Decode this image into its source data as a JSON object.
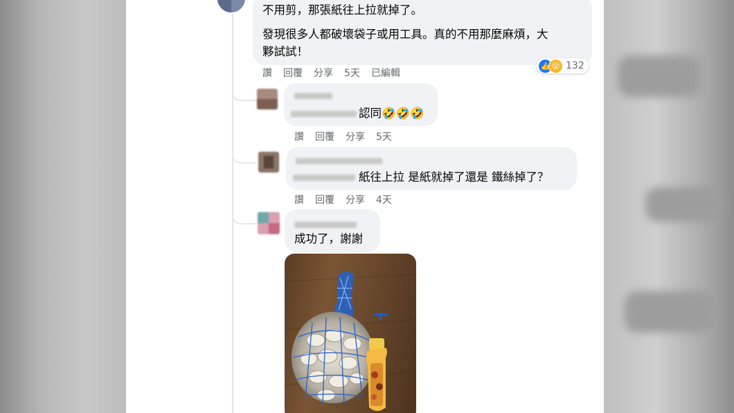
{
  "main_comment": {
    "line1": "不用剪，那張紙往上拉就掉了。",
    "line2": "發現很多人都破壞袋子或用工具。真的不用那麼麻煩，大",
    "line3": "夥試試！",
    "actions": {
      "like": "讚",
      "reply": "回覆",
      "share": "分享",
      "time": "5天",
      "edited": "已編輯"
    },
    "reaction_icons": [
      "like-icon",
      "wow-icon"
    ],
    "reaction_count": "132"
  },
  "replies": [
    {
      "text": "認同🤣🤣🤣",
      "actions": {
        "like": "讚",
        "reply": "回覆",
        "share": "分享",
        "time": "5天"
      }
    },
    {
      "text": "紙往上拉 是紙就掉了還是 鐵絲掉了？",
      "actions": {
        "like": "讚",
        "reply": "回覆",
        "share": "分享",
        "time": "4天"
      }
    },
    {
      "text": "成功了，謝謝"
    }
  ],
  "colors": {
    "bubble": "#f0f2f5",
    "action_text": "#65676b",
    "like_blue": "#1877f2",
    "wow_yellow": "#f7b928"
  }
}
